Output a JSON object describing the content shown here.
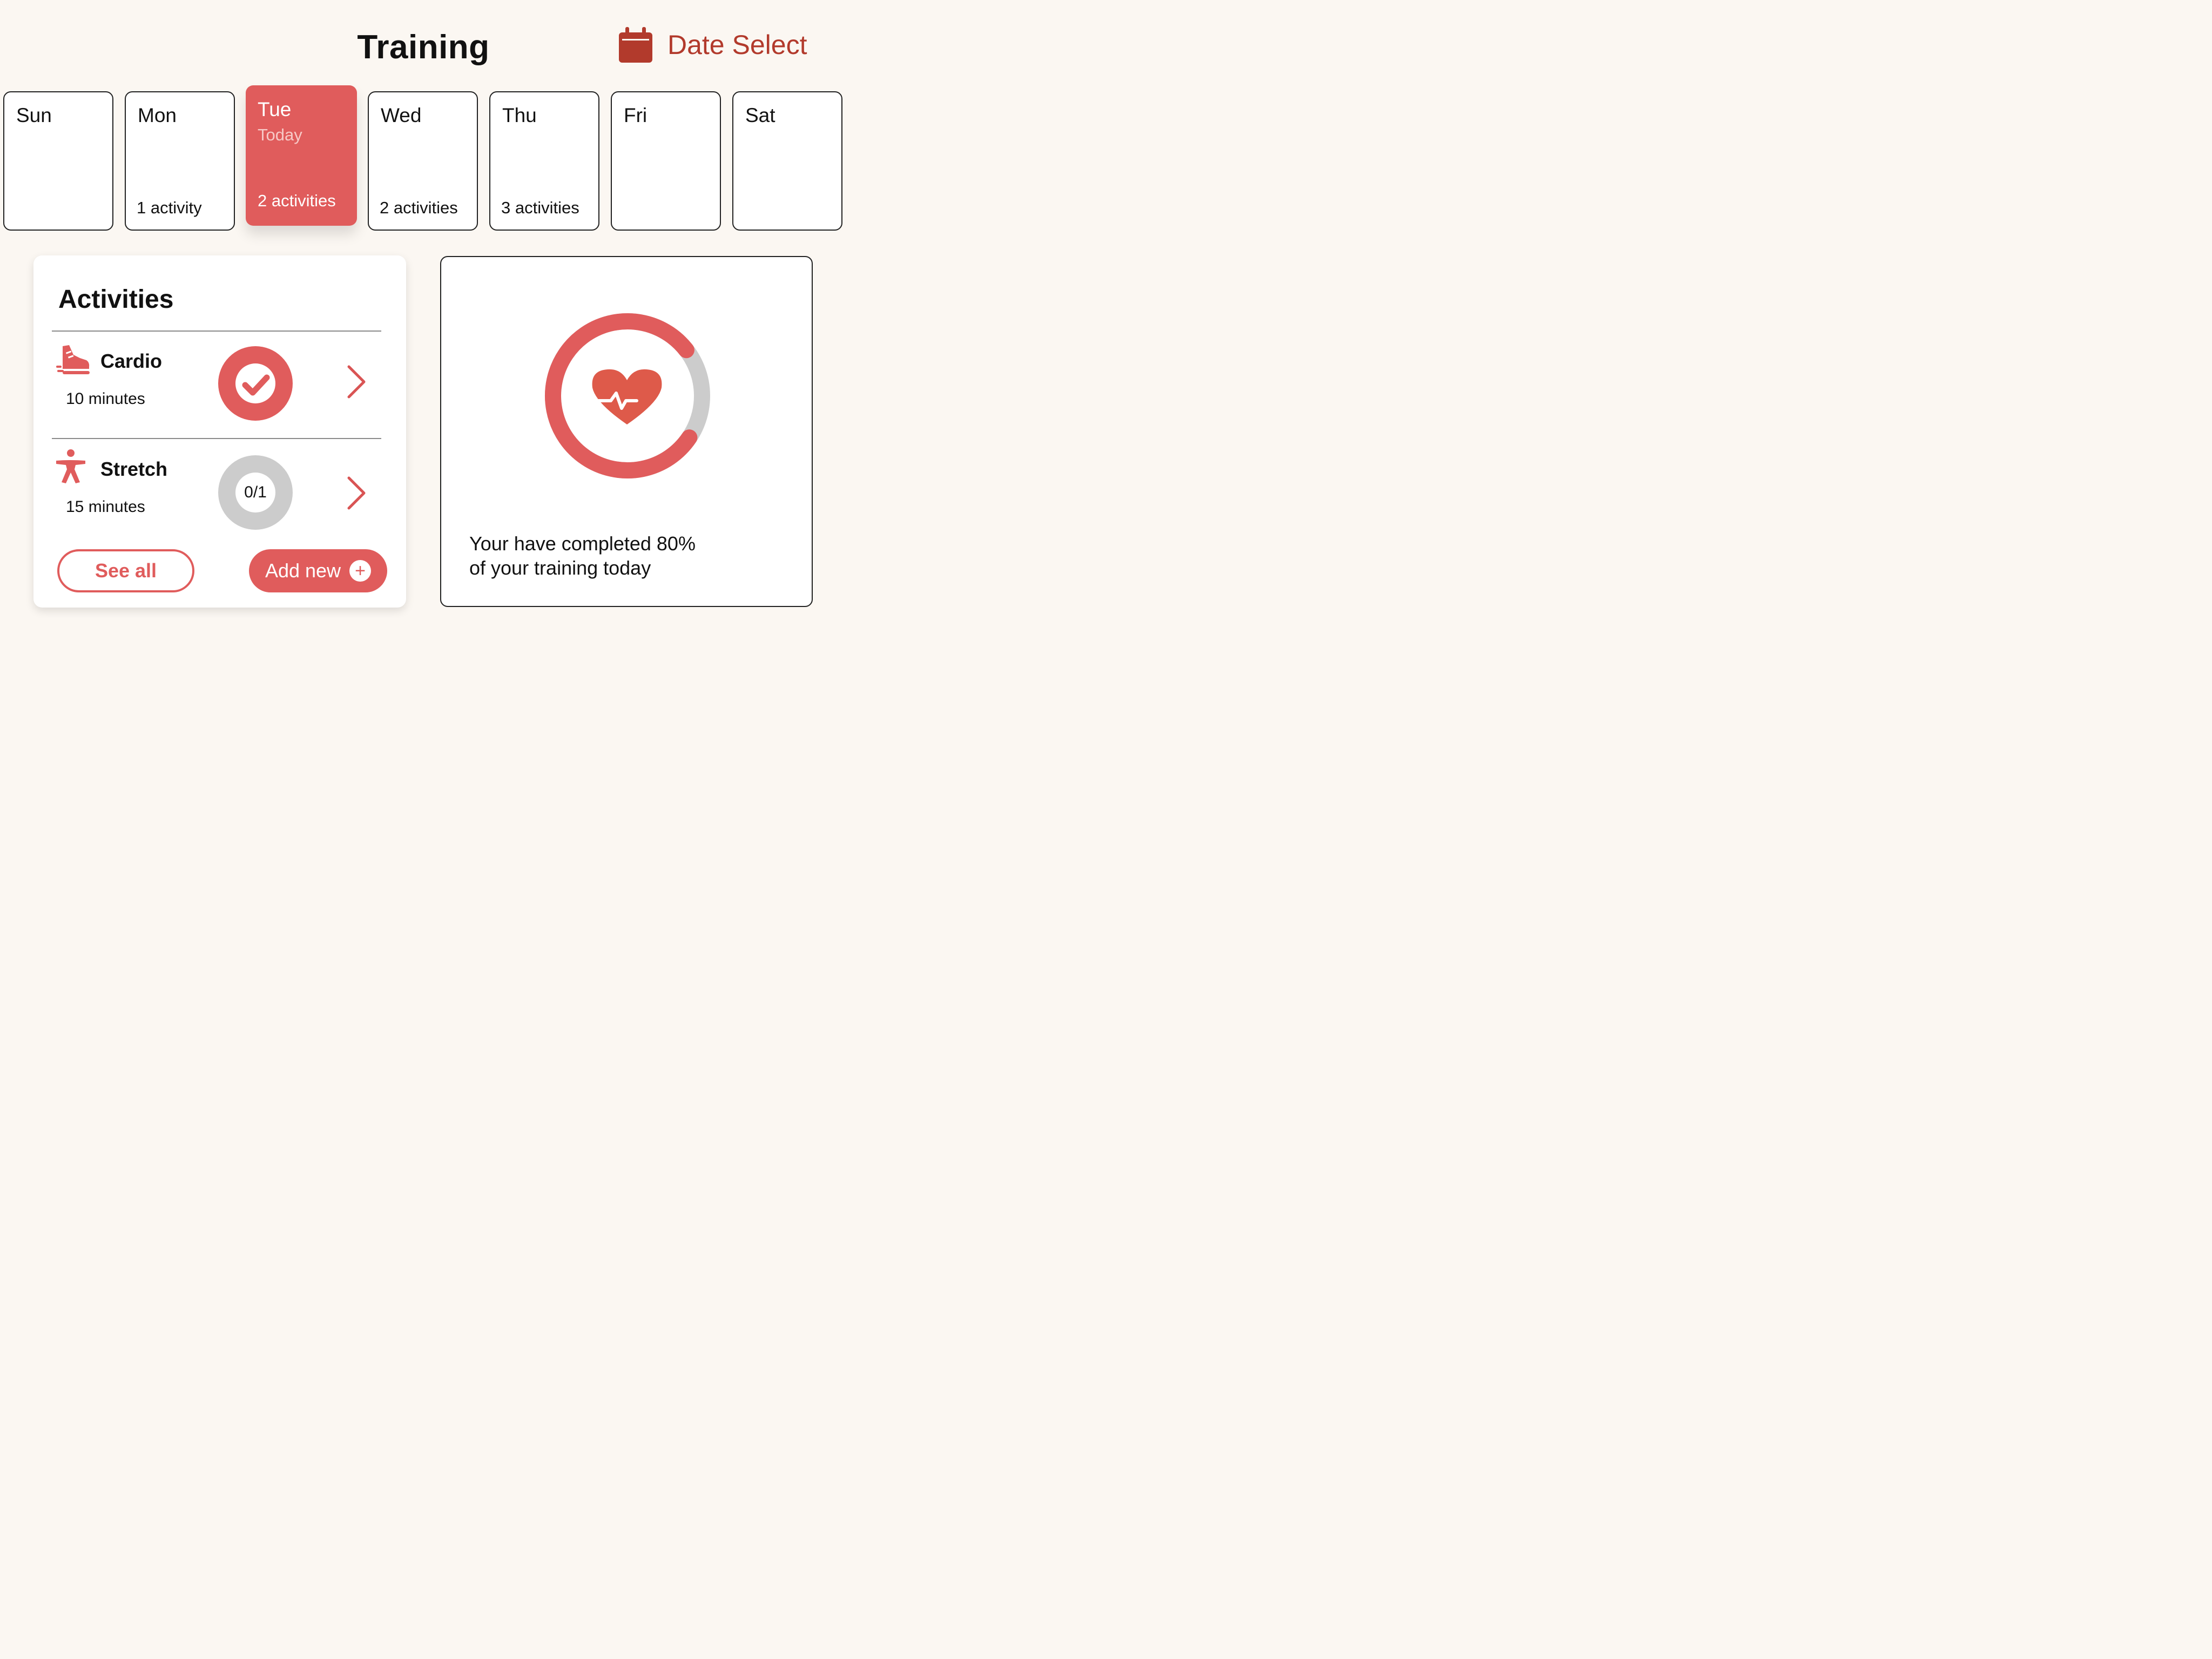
{
  "header": {
    "title": "Training",
    "date_select_label": "Date Select",
    "date_select_icon": "calendar-icon"
  },
  "week": {
    "days": [
      {
        "name": "Sun",
        "count": ""
      },
      {
        "name": "Mon",
        "count": "1 activity"
      },
      {
        "name": "Tue",
        "sub": "Today",
        "count": "2 activities",
        "active": true
      },
      {
        "name": "Wed",
        "count": "2 activities"
      },
      {
        "name": "Thu",
        "count": "3 activities"
      },
      {
        "name": "Fri",
        "count": ""
      },
      {
        "name": "Sat",
        "count": ""
      }
    ]
  },
  "activities": {
    "title": "Activities",
    "items": [
      {
        "name": "Cardio",
        "duration": "10 minutes",
        "icon": "running-shoe-icon",
        "status": "completed",
        "status_icon": "checkmark-icon"
      },
      {
        "name": "Stretch",
        "duration": "15 minutes",
        "icon": "stretch-person-icon",
        "status": "pending",
        "progress": "0/1"
      }
    ],
    "see_all_label": "See all",
    "add_new_label": "Add new",
    "add_new_icon": "plus-icon"
  },
  "summary": {
    "completion_fraction": 0.8,
    "icon": "heart-pulse-icon",
    "line1": "Your have completed 80%",
    "line2": "of your training today"
  },
  "colors": {
    "accent": "#e05c5c",
    "accent_dark": "#b23a2c",
    "track": "#cccccc",
    "background": "#fbf7f2"
  }
}
